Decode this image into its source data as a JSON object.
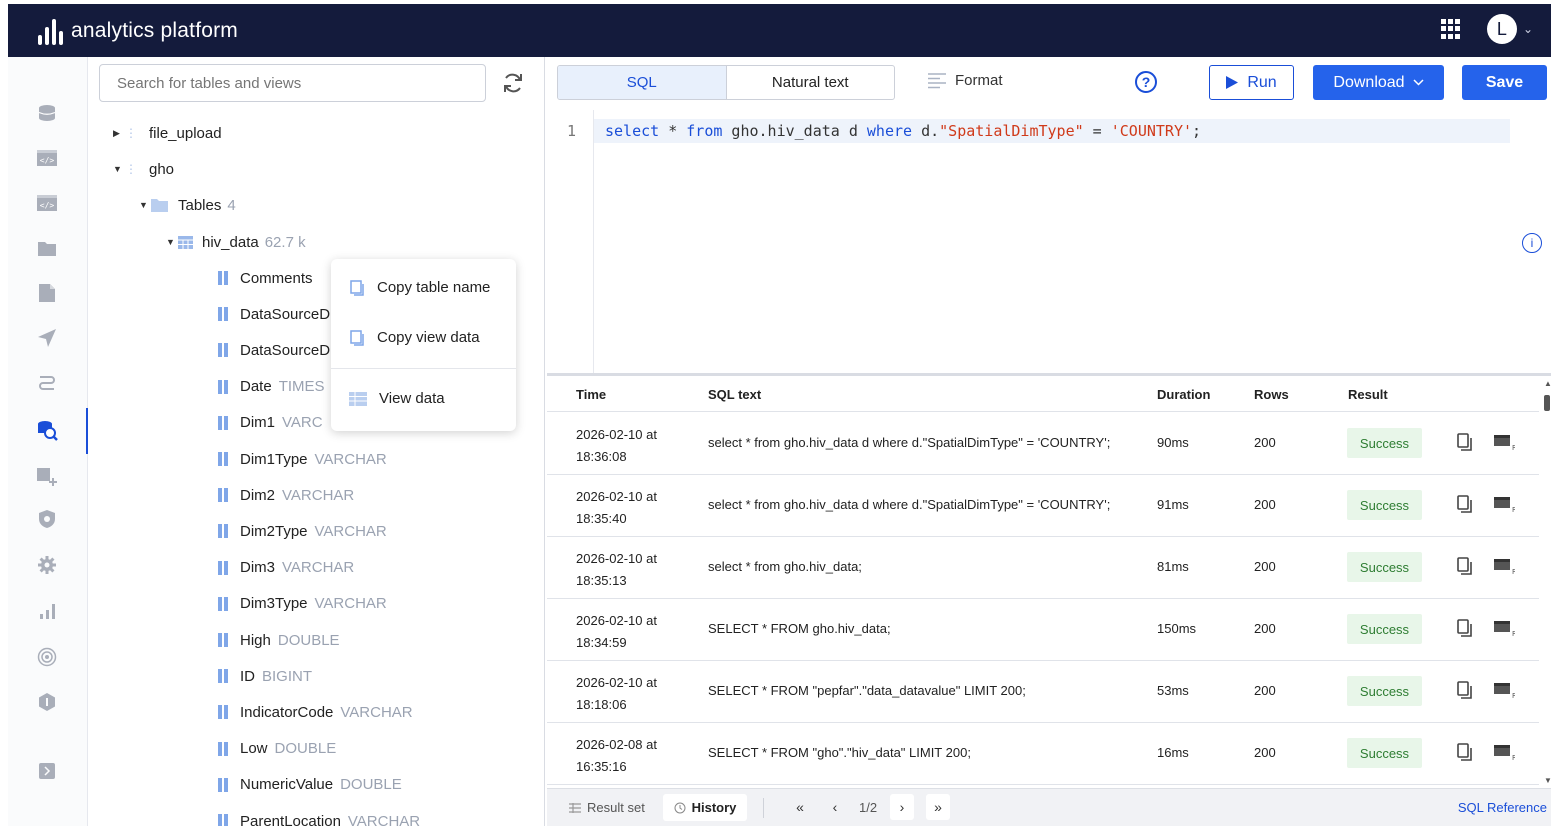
{
  "app": {
    "brand": "analytics platform",
    "avatar_letter": "L"
  },
  "sidebar": {
    "search_placeholder": "Search for tables and views",
    "tree": {
      "schema1": "file_upload",
      "schema2": "gho",
      "folder": "Tables",
      "folder_count": "4",
      "table": "hiv_data",
      "table_rows": "62.7 k",
      "columns": [
        {
          "name": "Comments",
          "type": ""
        },
        {
          "name": "DataSourceD",
          "type": ""
        },
        {
          "name": "DataSourceD",
          "type": ""
        },
        {
          "name": "Date",
          "type": "TIMES"
        },
        {
          "name": "Dim1",
          "type": "VARC"
        },
        {
          "name": "Dim1Type",
          "type": "VARCHAR"
        },
        {
          "name": "Dim2",
          "type": "VARCHAR"
        },
        {
          "name": "Dim2Type",
          "type": "VARCHAR"
        },
        {
          "name": "Dim3",
          "type": "VARCHAR"
        },
        {
          "name": "Dim3Type",
          "type": "VARCHAR"
        },
        {
          "name": "High",
          "type": "DOUBLE"
        },
        {
          "name": "ID",
          "type": "BIGINT"
        },
        {
          "name": "IndicatorCode",
          "type": "VARCHAR"
        },
        {
          "name": "Low",
          "type": "DOUBLE"
        },
        {
          "name": "NumericValue",
          "type": "DOUBLE"
        },
        {
          "name": "ParentLocation",
          "type": "VARCHAR"
        }
      ]
    }
  },
  "context_menu": {
    "copy_table_name": "Copy table name",
    "copy_view_data": "Copy view data",
    "view_data": "View data"
  },
  "editor": {
    "tab_sql": "SQL",
    "tab_natural": "Natural text",
    "format": "Format",
    "run": "Run",
    "download": "Download",
    "save": "Save",
    "line_number": "1",
    "code": {
      "select": "select",
      "star": " * ",
      "from": "from",
      "table": " gho.hiv_data d ",
      "where": "where",
      "col": " d.",
      "colname": "\"SpatialDimType\"",
      "eq": " = ",
      "val": "'COUNTRY'",
      "end": ";"
    }
  },
  "history": {
    "headers": {
      "time": "Time",
      "sql": "SQL text",
      "duration": "Duration",
      "rows": "Rows",
      "result": "Result"
    },
    "rows": [
      {
        "date": "2026-02-10 at",
        "clock": "18:36:08",
        "sql": "select * from gho.hiv_data d where d.\"SpatialDimType\" = 'COUNTRY';",
        "duration": "90ms",
        "rows": "200",
        "result": "Success"
      },
      {
        "date": "2026-02-10 at",
        "clock": "18:35:40",
        "sql": "select * from gho.hiv_data d where d.\"SpatialDimType\" = 'COUNTRY';",
        "duration": "91ms",
        "rows": "200",
        "result": "Success"
      },
      {
        "date": "2026-02-10 at",
        "clock": "18:35:13",
        "sql": "select * from gho.hiv_data;",
        "duration": "81ms",
        "rows": "200",
        "result": "Success"
      },
      {
        "date": "2026-02-10 at",
        "clock": "18:34:59",
        "sql": "SELECT * FROM gho.hiv_data;",
        "duration": "150ms",
        "rows": "200",
        "result": "Success"
      },
      {
        "date": "2026-02-10 at",
        "clock": "18:18:06",
        "sql": "SELECT * FROM \"pepfar\".\"data_datavalue\" LIMIT 200;",
        "duration": "53ms",
        "rows": "200",
        "result": "Success"
      },
      {
        "date": "2026-02-08 at",
        "clock": "16:35:16",
        "sql": "SELECT * FROM \"gho\".\"hiv_data\" LIMIT 200;",
        "duration": "16ms",
        "rows": "200",
        "result": "Success"
      }
    ]
  },
  "footer": {
    "result_set": "Result set",
    "history": "History",
    "page": "1/2",
    "sql_reference": "SQL Reference"
  },
  "colors": {
    "topbar": "#141b3c",
    "accent": "#2563eb",
    "success_bg": "#e8f6e9",
    "success_text": "#2e7d32"
  }
}
